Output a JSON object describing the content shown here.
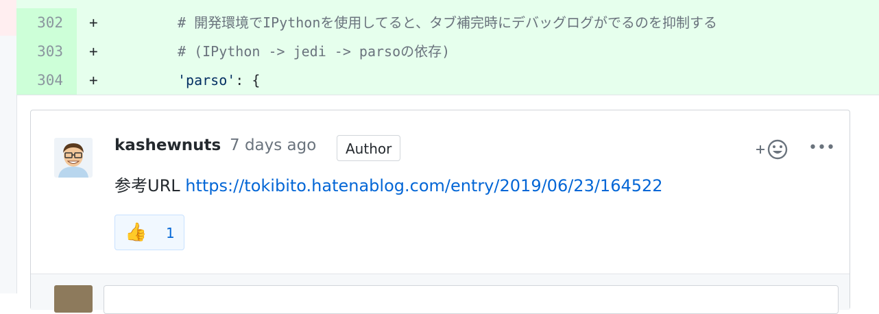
{
  "diff": {
    "rows": [
      {
        "line": "302",
        "sign": "+",
        "code": "# 開発環境でIPythonを使用してると、タブ補完時にデバッグログがでるのを抑制する"
      },
      {
        "line": "303",
        "sign": "+",
        "code": "# (IPython -> jedi -> parsoの依存)"
      },
      {
        "line": "304",
        "sign": "+",
        "code_str": "'parso'",
        "code_rest": ": {"
      }
    ]
  },
  "comment": {
    "author": "kashewnuts",
    "time": "7 days ago",
    "badge": "Author",
    "body_prefix": "参考URL",
    "link": "https://tokibito.hatenablog.com/entry/2019/06/23/164522",
    "reaction": {
      "emoji": "👍",
      "count": "1"
    },
    "more_label": "•••"
  },
  "icons": {
    "add_reaction": "smiley-plus-icon",
    "more": "kebab-horizontal-icon",
    "thumbs_up": "thumbs-up-icon"
  },
  "colors": {
    "added_bg": "#e6ffed",
    "added_gutter": "#cdffd8",
    "link": "#0366d6",
    "reaction_bg": "#f1f8ff"
  }
}
